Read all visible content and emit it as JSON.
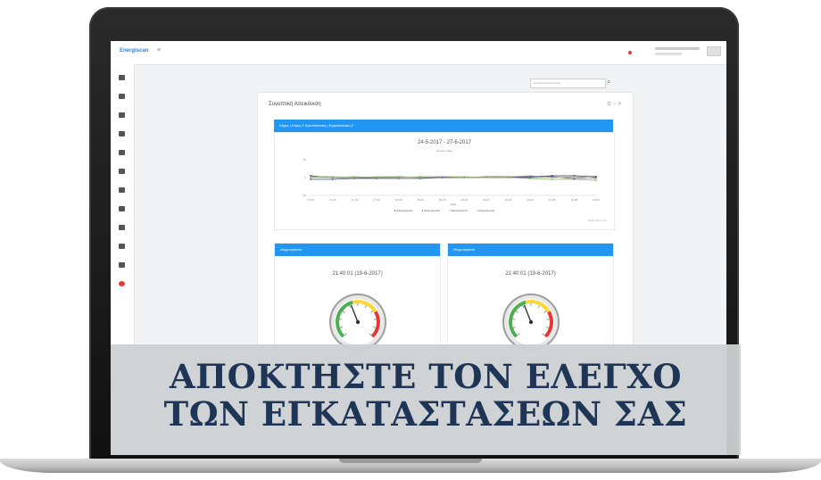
{
  "app": {
    "brand": "Energiscan",
    "menu_glyph": "≡"
  },
  "search": {
    "placeholder": "Επιλέξτε Εγκατάσταση",
    "button_glyph": "⌕"
  },
  "panel": {
    "title": "Συνοπτική Απεικόνιση",
    "tools": "⚙ ‒ ✕",
    "breadcrumb": "Κτίριο | Κτίριο 1 Εγκατάσταση | Εγκατάσταση 2"
  },
  "chart_data": {
    "type": "line",
    "title": "24-5-2017 - 27-6-2017",
    "subtitle": "Source: Data",
    "xlabel": "Date",
    "categories": [
      "17-06",
      "17-06",
      "17-06",
      "17-06",
      "18-06",
      "18-06",
      "18-06",
      "18-06",
      "18-06",
      "18-06",
      "19-06",
      "19-06",
      "19-06",
      "19-06"
    ],
    "ylim": [
      -20,
      20
    ],
    "y_ticks": [
      "20",
      "0",
      "-20"
    ],
    "series": [
      {
        "name": "Θερμοκρασία",
        "color": "#333333",
        "values": [
          2,
          0,
          0,
          0,
          1,
          0,
          0,
          0,
          1,
          1,
          1,
          2,
          2,
          1
        ]
      },
      {
        "name": "Θερμοκρασία",
        "color": "#4a4a8a",
        "values": [
          -2,
          -2,
          -1,
          -1,
          -1,
          -1,
          0,
          0,
          0,
          0,
          0,
          1,
          -1,
          0
        ]
      },
      {
        "name": "Θερμοκρασία",
        "color": "#7cb342",
        "values": [
          0,
          0,
          1,
          0,
          0,
          1,
          1,
          0,
          1,
          0,
          -1,
          -2,
          -2,
          -3
        ]
      },
      {
        "name": "Θερμοκρασία",
        "color": "#aaaaaa",
        "values": [
          1,
          1,
          0,
          1,
          1,
          0,
          1,
          1,
          0,
          1,
          2,
          0,
          1,
          -1
        ]
      }
    ],
    "credits": "Highcharts.com",
    "grid": false,
    "legend_position": "bottom"
  },
  "gauges": [
    {
      "header": "Θερμοκρασία",
      "time": "21:40:01 (19-6-2017)",
      "value_fraction": 0.42
    },
    {
      "header": "Θερμοκρασία",
      "time": "21:40:01 (19-6-2017)",
      "value_fraction": 0.42
    }
  ],
  "headline": {
    "line1": "ΑΠΟΚΤΗΣΤΕ ΤΟΝ ΕΛΕΓΧΟ",
    "line2": "ΤΩΝ ΕΓΚΑΤΑΣΤΑΣΕΩΝ ΣΑΣ"
  },
  "colors": {
    "accent": "#2196f3",
    "headline": "#1f3556",
    "alert": "#e53935"
  }
}
